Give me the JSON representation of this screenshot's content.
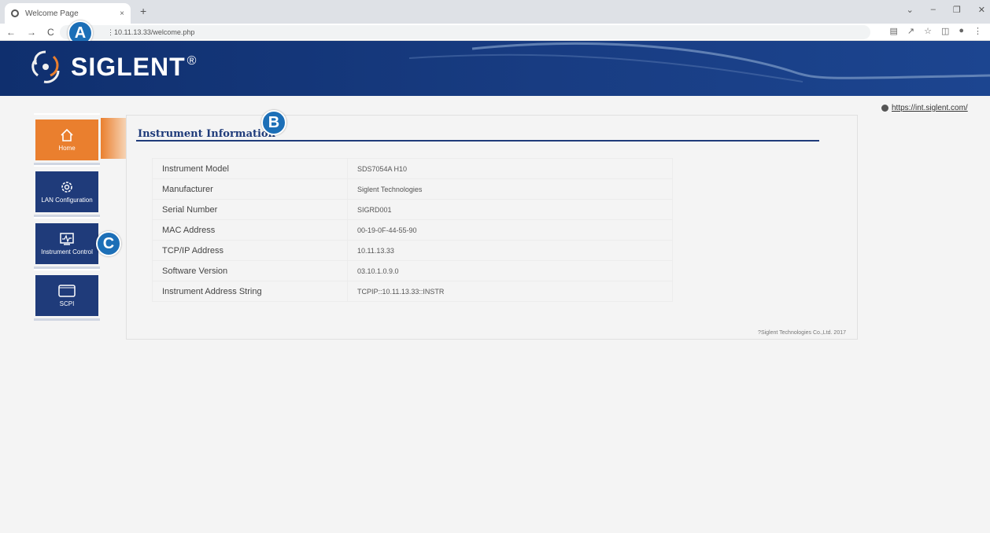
{
  "browser": {
    "tab_title": "Welcome Page",
    "tab_close": "×",
    "new_tab": "+",
    "url": "10.11.13.33/welcome.php",
    "url_prefix": "⋮ ",
    "win_controls": [
      "⌄",
      "–",
      "❐",
      "✕"
    ],
    "nav_icons": [
      "←",
      "→",
      "C"
    ]
  },
  "markers": {
    "a": "A",
    "b": "B",
    "c": "C"
  },
  "brand": {
    "name": "SIGLENT",
    "reg": "®",
    "accent": "#ea7f2e",
    "primary": "#1f3b7a"
  },
  "external_link": "https://int.siglent.com/",
  "sidebar": {
    "items": [
      {
        "label": "Home",
        "icon": "home-icon",
        "active": true
      },
      {
        "label": "LAN Configuration",
        "icon": "gear-icon",
        "active": false
      },
      {
        "label": "Instrument Control",
        "icon": "monitor-icon",
        "active": false
      },
      {
        "label": "SCPI",
        "icon": "terminal-icon",
        "active": false
      }
    ]
  },
  "panel": {
    "title": "Instrument Information",
    "rows": [
      {
        "key": "Instrument Model",
        "value": "SDS7054A H10"
      },
      {
        "key": "Manufacturer",
        "value": "Siglent Technologies"
      },
      {
        "key": "Serial Number",
        "value": "SIGRD001"
      },
      {
        "key": "MAC Address",
        "value": "00-19-0F-44-55-90"
      },
      {
        "key": "TCP/IP Address",
        "value": "10.11.13.33"
      },
      {
        "key": "Software Version",
        "value": "03.10.1.0.9.0"
      },
      {
        "key": "Instrument Address String",
        "value": "TCPIP::10.11.13.33::INSTR"
      }
    ],
    "footer": "?Siglent Technologies Co.,Ltd. 2017"
  }
}
